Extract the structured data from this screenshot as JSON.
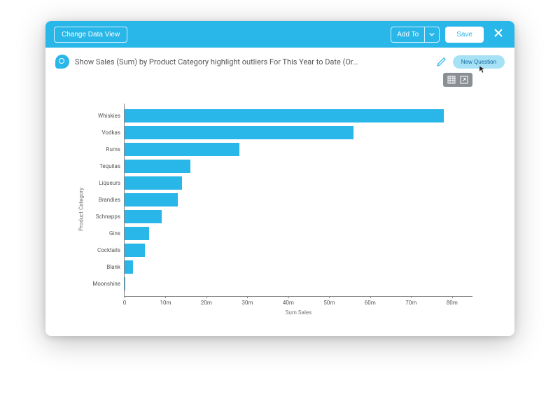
{
  "topbar": {
    "change_view_label": "Change Data View",
    "add_to_label": "Add To",
    "save_label": "Save"
  },
  "query": {
    "text": "Show Sales (Sum) by Product Category highlight outliers For This Year to Date (Or…",
    "new_question_label": "New Question"
  },
  "chart_data": {
    "type": "bar",
    "orientation": "horizontal",
    "title": "",
    "ylabel": "Product Category",
    "xlabel": "Sum Sales",
    "xlim": [
      0,
      85
    ],
    "xticks": [
      0,
      10,
      20,
      30,
      40,
      50,
      60,
      70,
      80
    ],
    "xtick_labels": [
      "0",
      "10m",
      "20m",
      "30m",
      "40m",
      "50m",
      "60m",
      "70m",
      "80m"
    ],
    "categories": [
      "Whiskies",
      "Vodkas",
      "Rums",
      "Tequilas",
      "Liqueurs",
      "Brandies",
      "Schnapps",
      "Gins",
      "Cocktails",
      "Blank",
      "Moonshine"
    ],
    "values": [
      78,
      56,
      28,
      16,
      14,
      13,
      9,
      6,
      5,
      2,
      0.2
    ],
    "series_color": "#29b6e8"
  }
}
